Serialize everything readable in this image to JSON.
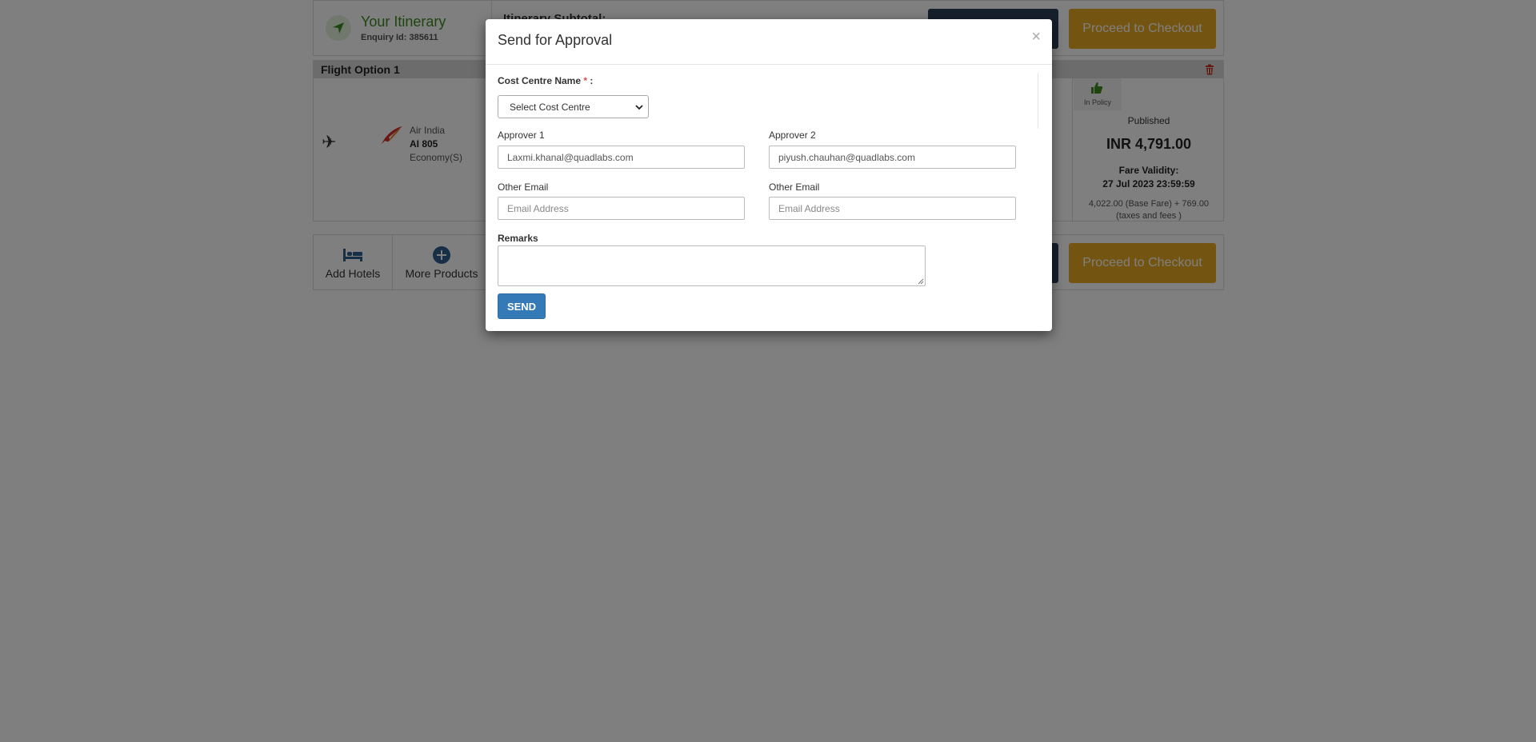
{
  "itinerary": {
    "title": "Your Itinerary",
    "enquiry": "Enquiry Id: 385611",
    "subtotal_label": "Itinerary Subtotal:",
    "checkout_label": "Proceed to Checkout"
  },
  "flight_option": {
    "label": "Flight Option 1",
    "airline": "Air India",
    "flight_number": "AI 805",
    "cabin": "Economy(S)",
    "policy": "In Policy",
    "fare_type": "Published",
    "price": "INR 4,791.00",
    "fare_validity_label": "Fare Validity:",
    "fare_validity_date": "27 Jul 2023 23:59:59",
    "fare_breakup_line1": "4,022.00 (Base Fare) + 769.00",
    "fare_breakup_line2": "(taxes and fees )"
  },
  "products": {
    "add_hotels": "Add Hotels",
    "more_products": "More Products",
    "checkout_label": "Proceed to Checkout"
  },
  "modal": {
    "title": "Send for Approval",
    "close": "×",
    "cost_centre_label": "Cost Centre Name",
    "required_mark": "*",
    "colon": " :",
    "cost_centre_selected": "Select Cost Centre",
    "approver1_label": "Approver 1",
    "approver1_value": "Laxmi.khanal@quadlabs.com",
    "approver2_label": "Approver 2",
    "approver2_value": "piyush.chauhan@quadlabs.com",
    "other_email1_label": "Other Email",
    "other_email1_placeholder": "Email Address",
    "other_email2_label": "Other Email",
    "other_email2_placeholder": "Email Address",
    "remarks_label": "Remarks",
    "send_label": "SEND"
  },
  "colors": {
    "accent_green": "#3c8a1e",
    "checkout_gold": "#e9a823",
    "send_blue": "#337ab7",
    "dark_navy": "#2c3e59"
  }
}
